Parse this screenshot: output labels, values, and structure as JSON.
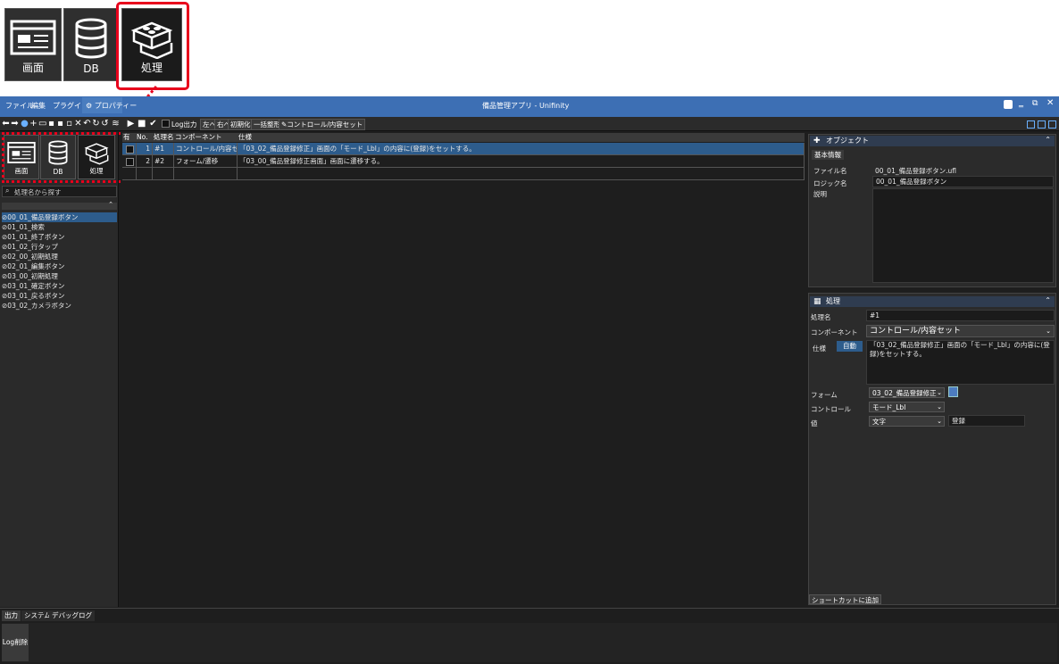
{
  "callout_large": {
    "screen_label": "画面",
    "db_label": "DB",
    "process_label": "処理"
  },
  "window": {
    "title": "備品管理アプリ - Unifinity"
  },
  "menu": {
    "file": "ファイル",
    "edit": "編集",
    "plugin": "プラグイン",
    "property": "⚙ プロパティー"
  },
  "toolbar": {
    "log_output": "Log出力",
    "left": "左へ",
    "right": "右へ",
    "init": "初期化",
    "bulk": "一括整形",
    "control_set": "✎コントロール/内容セット"
  },
  "left": {
    "screen_label": "画面",
    "db_label": "DB",
    "process_label": "処理",
    "search_placeholder": "処理名から探す",
    "items": [
      "00_01_備品登録ボタン",
      "01_01_検索",
      "01_01_終了ボタン",
      "01_02_行タップ",
      "02_00_初期処理",
      "02_01_編集ボタン",
      "03_00_初期処理",
      "03_01_確定ボタン",
      "03_01_戻るボタン",
      "03_02_カメラボタン"
    ]
  },
  "grid": {
    "headers": {
      "valid": "有効",
      "no": "No.",
      "name": "処理名",
      "component": "コンポーネント",
      "spec": "仕様"
    },
    "rows": [
      {
        "no": "1",
        "name": "#1",
        "component": "コントロール/内容セット",
        "spec": "「03_02_備品登録修正」画面の「モード_Lbl」の内容に(登録)をセットする。"
      },
      {
        "no": "2",
        "name": "#2",
        "component": "フォーム/遷移",
        "spec": "「03_00_備品登録修正画面」画面に遷移する。"
      }
    ]
  },
  "object_panel": {
    "title": "オブジェクト",
    "tab": "基本情報",
    "file_label": "ファイル名",
    "file_value": "00_01_備品登録ボタン.ufl",
    "logic_label": "ロジック名",
    "logic_value": "00_01_備品登録ボタン",
    "desc_label": "説明"
  },
  "process_panel": {
    "title": "処理",
    "name_label": "処理名",
    "name_value": "#1",
    "component_label": "コンポーネント",
    "component_value": "コントロール/内容セット",
    "spec_label": "仕様",
    "auto_label": "自動",
    "spec_value": "「03_02_備品登録修正」画面の「モード_Lbl」の内容に(登録)をセットする。",
    "form_label": "フォーム",
    "form_value": "03_02_備品登録修正",
    "control_label": "コントロール",
    "control_value": "モード_Lbl",
    "value_label": "値",
    "value_type": "文字",
    "value_value": "登録",
    "shortcut": "ショートカットに追加"
  },
  "bottom": {
    "tabs": [
      "出力",
      "システム",
      "デバッグログ"
    ],
    "log_clear": "Log削除"
  },
  "colors": {
    "accent": "#3d6fb4",
    "highlight": "#e8001c",
    "selected_row": "#2d5c8c"
  }
}
